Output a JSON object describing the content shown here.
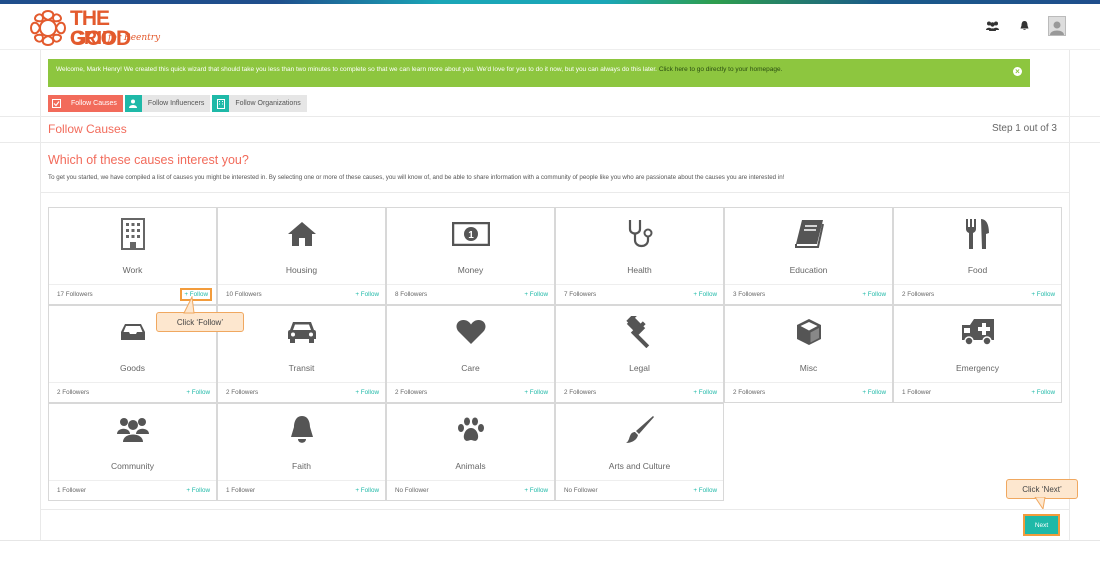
{
  "logo": {
    "line1": "THE GOOD",
    "line2": "GRID",
    "sub": "for Reentry"
  },
  "header": {
    "icons": [
      "users-icon",
      "bell-icon",
      "user-avatar"
    ]
  },
  "welcome": {
    "text": "Welcome, Mark Henry! We created this quick wizard that should take you less than two minutes to complete so that we can learn more about you. We'd love for you to do it now, but you can always do this later.",
    "link": "Click here to go directly to your homepage.",
    "close_icon": "close-icon"
  },
  "steps": [
    {
      "label": "Follow Causes",
      "icon": "check-square-icon",
      "state": "active"
    },
    {
      "label": "Follow Influencers",
      "icon": "user-icon",
      "state": "inactive"
    },
    {
      "label": "Follow Organizations",
      "icon": "building-icon",
      "state": "inactive"
    }
  ],
  "section": {
    "title": "Follow Causes",
    "step_count": "Step 1 out of 3"
  },
  "question": "Which of these causes interest you?",
  "intro": "To get you started, we have compiled a list of causes you might be interested in. By selecting one or more of these causes, you will know of, and be able to share information with a community of people like you who are passionate about the causes you are interested in!",
  "follow_label": "+ Follow",
  "causes": [
    {
      "name": "Work",
      "followers": "17 Followers",
      "icon": "building-icon"
    },
    {
      "name": "Housing",
      "followers": "10 Followers",
      "icon": "home-icon"
    },
    {
      "name": "Money",
      "followers": "8 Followers",
      "icon": "money-icon"
    },
    {
      "name": "Health",
      "followers": "7 Followers",
      "icon": "stethoscope-icon"
    },
    {
      "name": "Education",
      "followers": "3 Followers",
      "icon": "book-icon"
    },
    {
      "name": "Food",
      "followers": "2 Followers",
      "icon": "cutlery-icon"
    },
    {
      "name": "Goods",
      "followers": "2 Followers",
      "icon": "inbox-icon"
    },
    {
      "name": "Transit",
      "followers": "2 Followers",
      "icon": "car-icon"
    },
    {
      "name": "Care",
      "followers": "2 Followers",
      "icon": "heart-icon"
    },
    {
      "name": "Legal",
      "followers": "2 Followers",
      "icon": "gavel-icon"
    },
    {
      "name": "Misc",
      "followers": "2 Followers",
      "icon": "cube-icon"
    },
    {
      "name": "Emergency",
      "followers": "1 Follower",
      "icon": "ambulance-icon"
    },
    {
      "name": "Community",
      "followers": "1 Follower",
      "icon": "users-icon"
    },
    {
      "name": "Faith",
      "followers": "1 Follower",
      "icon": "bell-icon"
    },
    {
      "name": "Animals",
      "followers": "No Follower",
      "icon": "paw-icon"
    },
    {
      "name": "Arts and Culture",
      "followers": "No Follower",
      "icon": "paintbrush-icon"
    }
  ],
  "callouts": {
    "follow": "Click ‘Follow’",
    "next": "Click ‘Next’"
  },
  "next_label": "Next",
  "colors": {
    "accent": "#f26b5b",
    "teal": "#1fb9a8",
    "green": "#8dc63f",
    "highlight": "#f39c3c"
  }
}
